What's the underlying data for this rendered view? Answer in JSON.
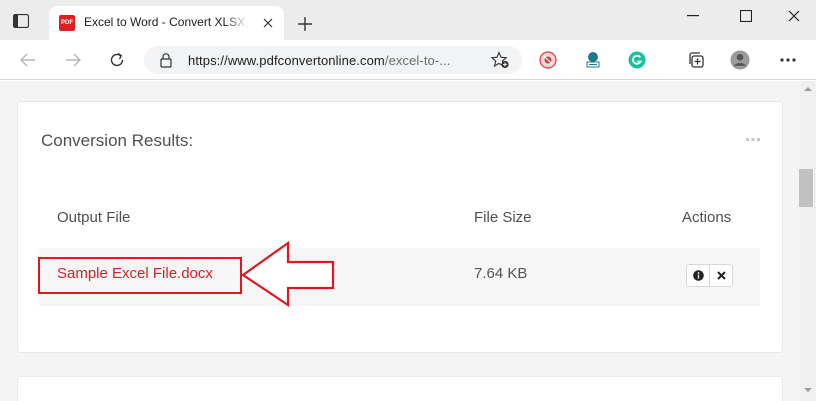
{
  "browser": {
    "tab": {
      "favicon_text": "PDF",
      "title": "Excel to Word - Convert XLSX, XLS to DOCX"
    },
    "address": {
      "host": "https://www.pdfconvertonline.com",
      "path": "/excel-to-..."
    },
    "icons": {
      "tab_actions": "tab-actions-icon",
      "close_tab": "close-icon",
      "new_tab": "plus-icon",
      "minimize": "minimize-icon",
      "maximize": "maximize-icon",
      "close_window": "close-icon",
      "back": "back-arrow-icon",
      "forward": "forward-arrow-icon",
      "refresh": "refresh-icon",
      "lock": "lock-icon",
      "favorites": "favorites-star-icon",
      "extensions": [
        "shield-extension-icon",
        "adblock-extension-icon",
        "grammarly-icon"
      ],
      "collections": "collections-icon",
      "profile": "profile-avatar-icon"
    },
    "colors": {
      "grammarly": "#15c39a",
      "extension_red": "#d73e3e",
      "extension_teal": "#1d7a8a"
    }
  },
  "conversion": {
    "title": "Conversion Results:",
    "headers": {
      "output_file": "Output File",
      "file_size": "File Size",
      "actions": "Actions"
    },
    "rows": [
      {
        "file_name": "Sample Excel File.docx",
        "file_size": "7.64 KB"
      }
    ],
    "colors": {
      "link": "#d6202a",
      "highlight": "#e3161e"
    }
  }
}
